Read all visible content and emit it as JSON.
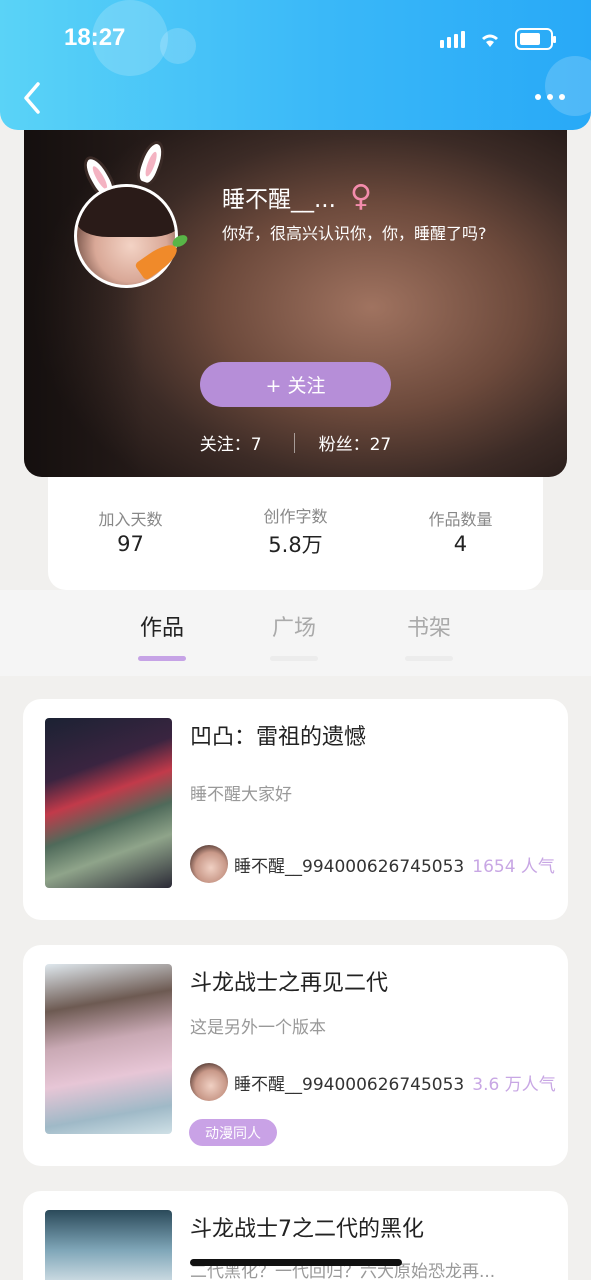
{
  "status_bar": {
    "time": "18:27"
  },
  "profile": {
    "username": "睡不醒__...",
    "gender_icon": "female-icon",
    "bio": "你好，很高兴认识你，你，睡醒了吗?",
    "follow_button": "+ 关注",
    "following_label": "关注：7",
    "fans_label": "粉丝：27"
  },
  "stats": [
    {
      "label": "加入天数",
      "value": "97"
    },
    {
      "label": "创作字数",
      "value": "5.8万"
    },
    {
      "label": "作品数量",
      "value": "4"
    }
  ],
  "tabs": [
    {
      "label": "作品",
      "active": true
    },
    {
      "label": "广场",
      "active": false
    },
    {
      "label": "书架",
      "active": false
    }
  ],
  "works": [
    {
      "title": "凹凸：雷祖的遗憾",
      "desc": "睡不醒大家好",
      "author": "睡不醒__994000626745053",
      "popularity": "1654 人气",
      "tag": ""
    },
    {
      "title": "斗龙战士之再见二代",
      "desc": "这是另外一个版本",
      "author": "睡不醒__994000626745053",
      "popularity": "3.6 万人气",
      "tag": "动漫同人"
    },
    {
      "title": "斗龙战士7之二代的黑化",
      "desc": "二代黑化？一代回归？六大原始恐龙再...",
      "author": "",
      "popularity": "",
      "tag": ""
    }
  ],
  "colors": {
    "header_blue": "#3ab8f8",
    "accent_purple": "#b68ed8",
    "popularity_purple": "#c8a7e4"
  }
}
